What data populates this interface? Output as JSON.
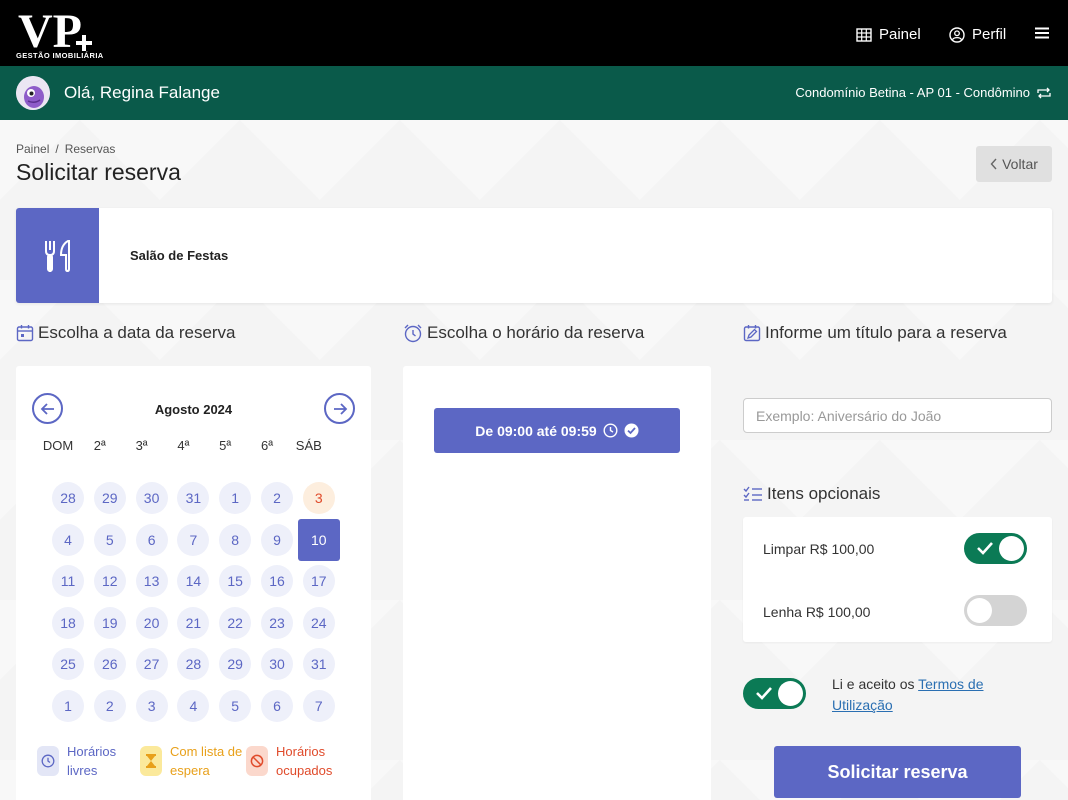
{
  "header": {
    "logo_text": "GESTÃO IMOBILIÁRIA",
    "nav": [
      {
        "label": "Painel",
        "icon": "grid-icon"
      },
      {
        "label": "Perfil",
        "icon": "user-circle-icon"
      }
    ],
    "menu_icon": "hamburger-icon"
  },
  "userbar": {
    "greeting": "Olá, Regina Falange",
    "condo": "Condomínio Betina - AP 01 - Condômino",
    "switch_icon": "repeat-icon"
  },
  "breadcrumb": [
    "Painel",
    "/",
    "Reservas"
  ],
  "page_title": "Solicitar reserva",
  "back_label": "Voltar",
  "space": {
    "name": "Salão de Festas",
    "icon": "cutlery-icon"
  },
  "sections": {
    "date": "Escolha a data da reserva",
    "time": "Escolha o horário da reserva",
    "title": "Informe um título para a reserva",
    "optional": "Itens opcionais"
  },
  "calendar": {
    "month": "Agosto 2024",
    "weekdays": [
      "DOM",
      "2ª",
      "3ª",
      "4ª",
      "5ª",
      "6ª",
      "SÁB"
    ],
    "weeks": [
      [
        "28",
        "29",
        "30",
        "31",
        "1",
        "2",
        "3"
      ],
      [
        "4",
        "5",
        "6",
        "7",
        "8",
        "9",
        "10"
      ],
      [
        "11",
        "12",
        "13",
        "14",
        "15",
        "16",
        "17"
      ],
      [
        "18",
        "19",
        "20",
        "21",
        "22",
        "23",
        "24"
      ],
      [
        "25",
        "26",
        "27",
        "28",
        "29",
        "30",
        "31"
      ],
      [
        "1",
        "2",
        "3",
        "4",
        "5",
        "6",
        "7"
      ]
    ],
    "busy_day": "3",
    "selected_day": "10",
    "legend": {
      "free": [
        "Horários",
        "livres"
      ],
      "waitlist": [
        "Com lista de",
        "espera"
      ],
      "busy": [
        "Horários",
        "ocupados"
      ]
    }
  },
  "time_slot": {
    "label": "De 09:00 até 09:59"
  },
  "title_input": {
    "placeholder": "Exemplo: Aniversário do João",
    "value": ""
  },
  "optional_items": [
    {
      "label": "Limpar R$ 100,00",
      "enabled": true
    },
    {
      "label": "Lenha R$ 100,00",
      "enabled": false
    }
  ],
  "terms": {
    "prefix": "Li e aceito os ",
    "link": "Termos de Utilização",
    "accepted": true
  },
  "submit_label": "Solicitar reserva",
  "colors": {
    "primary": "#5c67c4",
    "green": "#0b7a55",
    "header_green": "#0a5a4a"
  }
}
